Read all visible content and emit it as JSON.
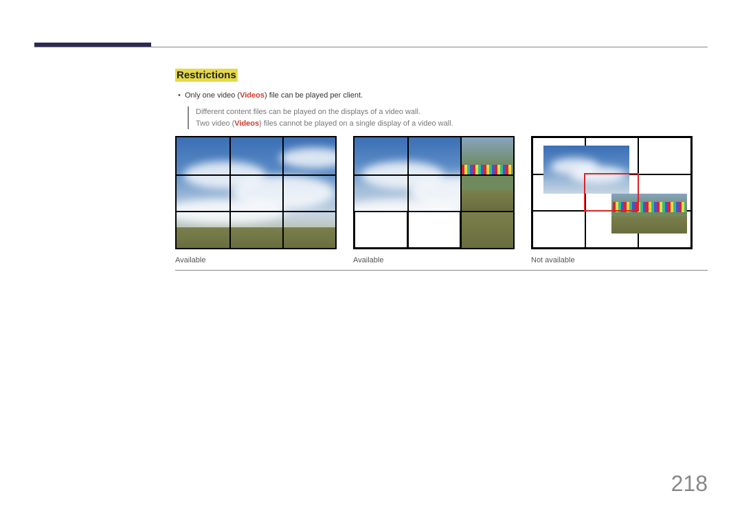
{
  "section": {
    "title": "Restrictions"
  },
  "bullet": {
    "prefix": "Only one video (",
    "videos": "Videos",
    "suffix": ") file can be played per client."
  },
  "note": {
    "line1": "Different content files can be played on the displays of a video wall.",
    "line2_prefix": "Two video (",
    "line2_videos": "Videos",
    "line2_suffix": ") files cannot be played on a single display of a video wall."
  },
  "captions": {
    "fig1": "Available",
    "fig2": "Available",
    "fig3": "Not available"
  },
  "page": {
    "number": "218"
  }
}
